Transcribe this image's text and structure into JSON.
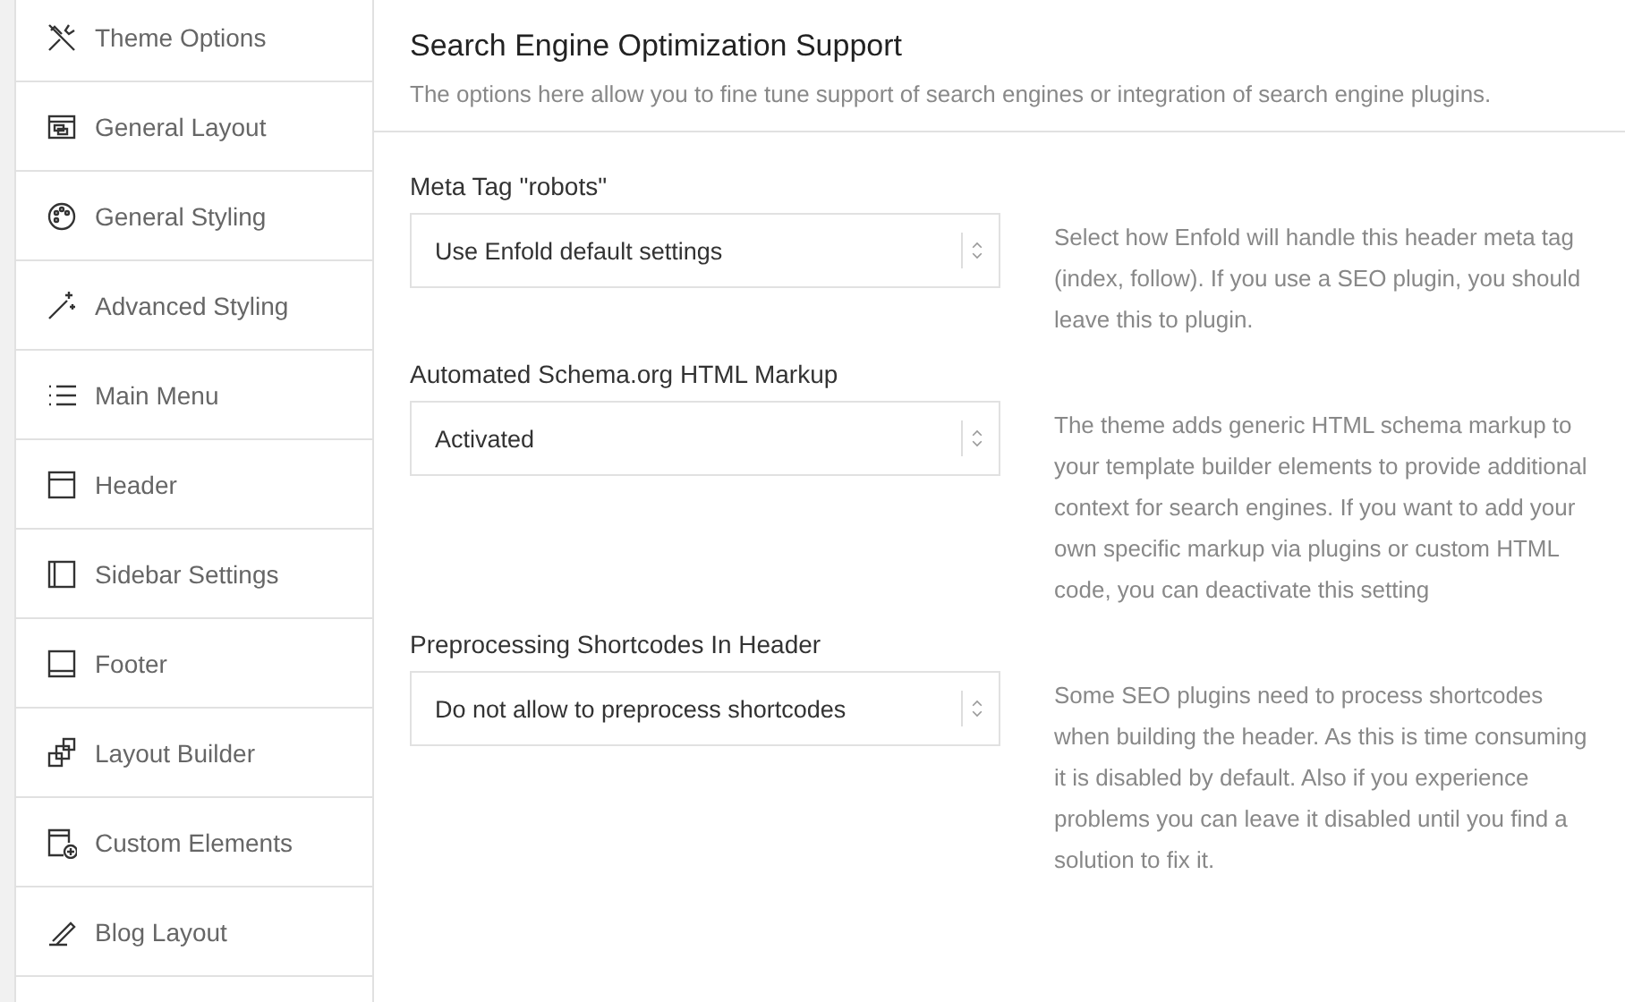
{
  "sidebar": {
    "items": [
      {
        "label": "Theme Options",
        "selected": false
      },
      {
        "label": "General Layout",
        "selected": false
      },
      {
        "label": "General Styling",
        "selected": false
      },
      {
        "label": "Advanced Styling",
        "selected": false
      },
      {
        "label": "Main Menu",
        "selected": false
      },
      {
        "label": "Header",
        "selected": false
      },
      {
        "label": "Sidebar Settings",
        "selected": false
      },
      {
        "label": "Footer",
        "selected": false
      },
      {
        "label": "Layout Builder",
        "selected": false
      },
      {
        "label": "Custom Elements",
        "selected": false
      },
      {
        "label": "Blog Layout",
        "selected": false
      }
    ]
  },
  "page": {
    "title": "Search Engine Optimization Support",
    "description": "The options here allow you to fine tune support of search engines or integration of search engine plugins."
  },
  "options": [
    {
      "label": "Meta Tag \"robots\"",
      "value": "Use Enfold default settings",
      "help": "Select how Enfold will handle this header meta tag (index, follow). If you use a SEO plugin, you should leave this to plugin."
    },
    {
      "label": "Automated Schema.org HTML Markup",
      "value": "Activated",
      "help": "The theme adds generic HTML schema markup to your template builder elements to provide additional context for search engines. If you want to add your own specific markup via plugins or custom HTML code, you can deactivate this setting"
    },
    {
      "label": "Preprocessing Shortcodes In Header",
      "value": "Do not allow to preprocess shortcodes",
      "help": "Some SEO plugins need to process shortcodes when building the header. As this is time consuming it is disabled by default. Also if you experience problems you can leave it disabled until you find a solution to fix it."
    }
  ]
}
